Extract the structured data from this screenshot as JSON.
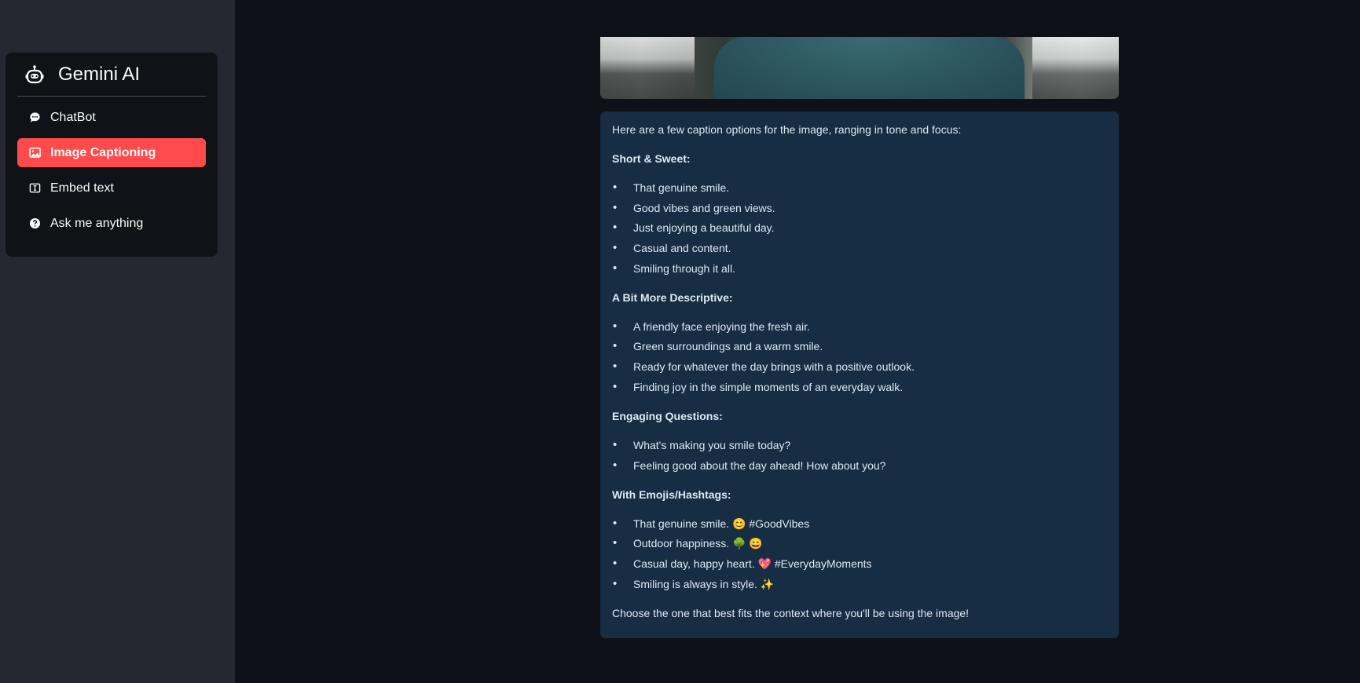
{
  "sidebar": {
    "app_title": "Gemini AI",
    "items": [
      {
        "label": "ChatBot",
        "icon": "chat-bubble-icon",
        "active": false
      },
      {
        "label": "Image Captioning",
        "icon": "image-icon",
        "active": true
      },
      {
        "label": "Embed text",
        "icon": "textarea-icon",
        "active": false
      },
      {
        "label": "Ask me anything",
        "icon": "question-circle-icon",
        "active": false
      }
    ]
  },
  "colors": {
    "app_background": "#0e1117",
    "sidebar_background": "#262730",
    "menu_background": "#111217",
    "active_item": "#ff4b4b",
    "response_background": "#172d43"
  },
  "response": {
    "intro": "Here are a few caption options for the image, ranging in tone and focus:",
    "sections": [
      {
        "heading": "Short & Sweet:",
        "items": [
          "That genuine smile.",
          "Good vibes and green views.",
          "Just enjoying a beautiful day.",
          "Casual and content.",
          "Smiling through it all."
        ]
      },
      {
        "heading": "A Bit More Descriptive:",
        "items": [
          "A friendly face enjoying the fresh air.",
          "Green surroundings and a warm smile.",
          "Ready for whatever the day brings with a positive outlook.",
          "Finding joy in the simple moments of an everyday walk."
        ]
      },
      {
        "heading": "Engaging Questions:",
        "items": [
          "What's making you smile today?",
          "Feeling good about the day ahead! How about you?"
        ]
      },
      {
        "heading": "With Emojis/Hashtags:",
        "items": [
          "That genuine smile. 😊 #GoodVibes",
          "Outdoor happiness. 🌳 😄",
          "Casual day, happy heart. 💖 #EverydayMoments",
          "Smiling is always in style. ✨"
        ]
      }
    ],
    "outro": "Choose the one that best fits the context where you'll be using the image!"
  }
}
